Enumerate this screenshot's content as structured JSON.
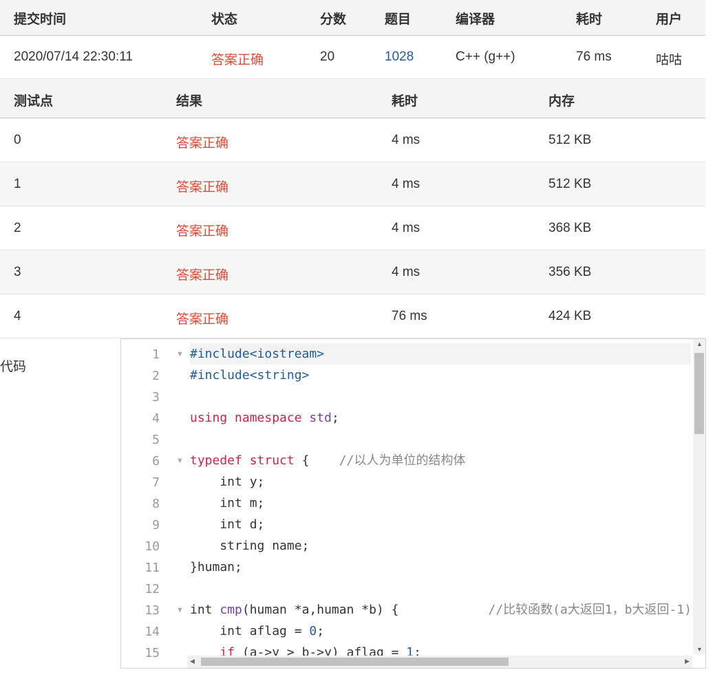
{
  "submission": {
    "headers": [
      "提交时间",
      "状态",
      "分数",
      "题目",
      "编译器",
      "耗时",
      "用户"
    ],
    "time": "2020/07/14 22:30:11",
    "status": "答案正确",
    "score": "20",
    "problem": "1028",
    "compiler": "C++ (g++)",
    "duration": "76 ms",
    "user": "咕咕"
  },
  "tests": {
    "headers": [
      "测试点",
      "结果",
      "耗时",
      "内存"
    ],
    "rows": [
      {
        "id": "0",
        "result": "答案正确",
        "time": "4 ms",
        "memory": "512 KB"
      },
      {
        "id": "1",
        "result": "答案正确",
        "time": "4 ms",
        "memory": "512 KB"
      },
      {
        "id": "2",
        "result": "答案正确",
        "time": "4 ms",
        "memory": "368 KB"
      },
      {
        "id": "3",
        "result": "答案正确",
        "time": "4 ms",
        "memory": "356 KB"
      },
      {
        "id": "4",
        "result": "答案正确",
        "time": "76 ms",
        "memory": "424 KB"
      }
    ]
  },
  "code": {
    "label": "代码",
    "line_numbers": [
      "1",
      "2",
      "3",
      "4",
      "5",
      "6",
      "7",
      "8",
      "9",
      "10",
      "11",
      "12",
      "13",
      "14",
      "15"
    ],
    "lines": [
      "#include<iostream>",
      "#include<string>",
      "",
      "using namespace std;",
      "",
      "typedef struct {    //以人为单位的结构体",
      "    int y;",
      "    int m;",
      "    int d;",
      "    string name;",
      "}human;",
      "",
      "int cmp(human *a,human *b) {            //比较函数(a大返回1，b大返回-1)",
      "    int aflag = 0;",
      "    if (a->y > b->y) aflag = 1;"
    ]
  },
  "colors": {
    "accent_ok": "#d94d3a",
    "link": "#1f5c9a",
    "header_bg": "#f4f4f4"
  }
}
